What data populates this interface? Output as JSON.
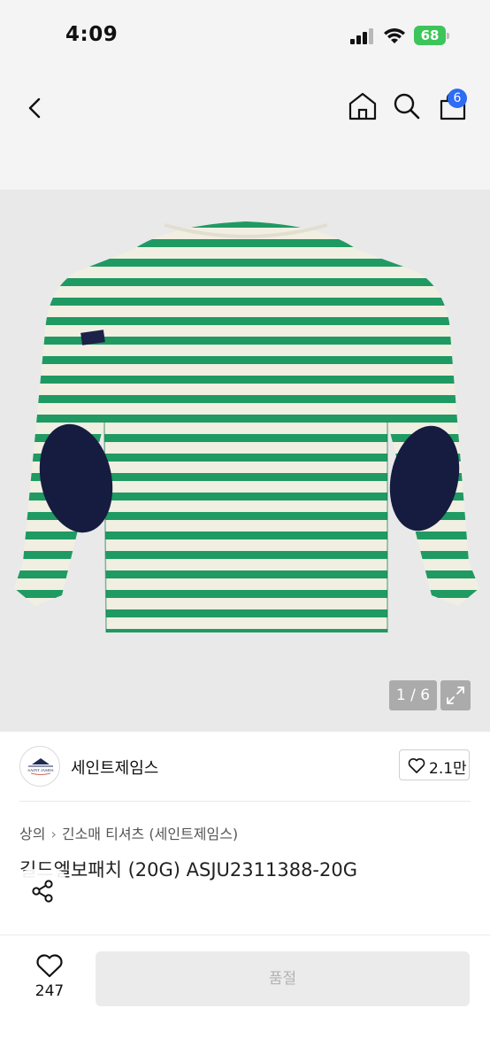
{
  "status_bar": {
    "time": "4:09",
    "battery": "68"
  },
  "nav": {
    "cart_count": "6",
    "icons": [
      "back-icon",
      "home-icon",
      "search-icon",
      "cart-icon"
    ]
  },
  "product": {
    "image_counter": "1 / 6",
    "image_colors": {
      "background": "#e9e9e9",
      "stripe_green": "#1f9a63",
      "stripe_cream": "#f1efe2",
      "elbow_patch": "#151c3f"
    },
    "brand": {
      "name": "세인트제임스",
      "logo_text": "SAINT JAMES",
      "likes": "2.1만"
    },
    "breadcrumb": [
      "상의",
      "긴소매 티셔츠 (세인트제임스)"
    ],
    "title": "길드엘보패치 (20G) ASJU2311388-20G"
  },
  "bottom_bar": {
    "wish_count": "247",
    "soldout_label": "품절"
  }
}
